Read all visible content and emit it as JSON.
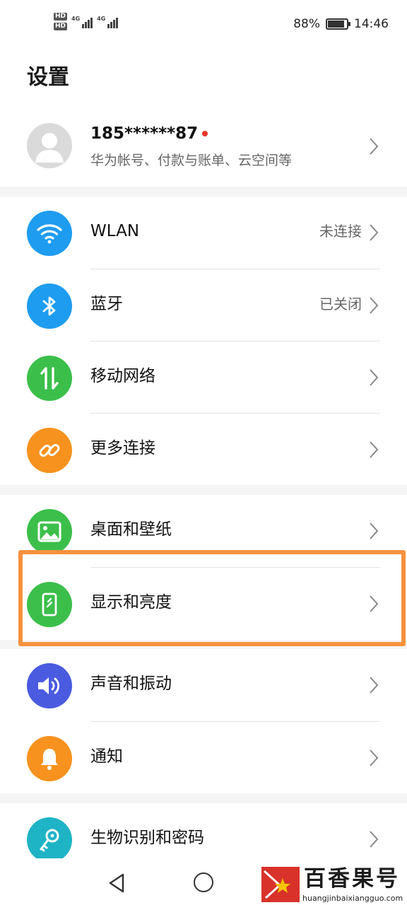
{
  "status_bar": {
    "hd1": "HD",
    "hd2": "HD",
    "net1": "4G",
    "net2": "4G",
    "battery_percent": "88%",
    "battery_level": 0.88,
    "time": "14:46"
  },
  "header": {
    "title": "设置"
  },
  "account": {
    "name": "185******87",
    "subtitle": "华为帐号、付款与账单、云空间等"
  },
  "connectivity": [
    {
      "label": "WLAN",
      "value": "未连接",
      "icon": "wifi-icon",
      "color": "#1e9cf0"
    },
    {
      "label": "蓝牙",
      "value": "已关闭",
      "icon": "bluetooth-icon",
      "color": "#1e9cf0"
    },
    {
      "label": "移动网络",
      "value": "",
      "icon": "mobile-data-icon",
      "color": "#3bbf4a"
    },
    {
      "label": "更多连接",
      "value": "",
      "icon": "link-icon",
      "color": "#f7921e"
    }
  ],
  "display": [
    {
      "label": "桌面和壁纸",
      "icon": "wallpaper-icon",
      "color": "#3bbf4a"
    },
    {
      "label": "显示和亮度",
      "icon": "display-icon",
      "color": "#3bbf4a"
    }
  ],
  "sound_notify": [
    {
      "label": "声音和振动",
      "icon": "speaker-icon",
      "color": "#4a5be0"
    },
    {
      "label": "通知",
      "icon": "bell-icon",
      "color": "#f7921e"
    }
  ],
  "security": [
    {
      "label": "生物识别和密码",
      "icon": "key-icon",
      "color": "#1fb3c6"
    }
  ],
  "highlight_color": "#f7913d",
  "watermark": {
    "title": "百香果号",
    "url": "huangjinbaixiangguo.com"
  }
}
